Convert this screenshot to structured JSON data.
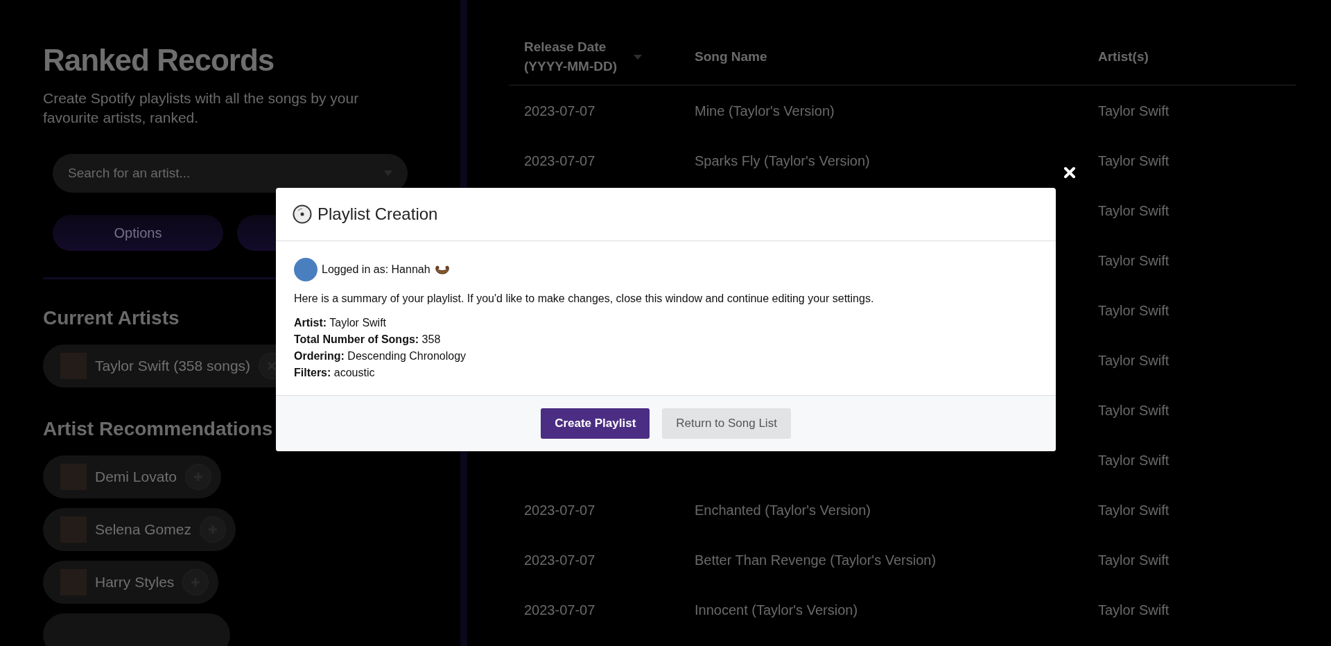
{
  "sidebar": {
    "title": "Ranked Records",
    "subtitle": "Create Spotify playlists with all the songs by your favourite artists, ranked.",
    "search": {
      "placeholder": "Search for an artist..."
    },
    "buttons": [
      {
        "label": "Options"
      }
    ],
    "current_artists_heading": "Current Artists",
    "current_artists": [
      {
        "name": "Taylor Swift (358 songs)"
      }
    ],
    "recommendations_heading": "Artist Recommendations",
    "recommendations": [
      {
        "name": "Demi Lovato"
      },
      {
        "name": "Selena Gomez"
      },
      {
        "name": "Harry Styles"
      }
    ]
  },
  "table": {
    "columns": [
      "Release Date (YYYY-MM-DD)",
      "Song Name",
      "Artist(s)"
    ],
    "rows": [
      {
        "date": "2023-07-07",
        "song": "Mine (Taylor's Version)",
        "artist": "Taylor Swift"
      },
      {
        "date": "2023-07-07",
        "song": "Sparks Fly (Taylor's Version)",
        "artist": "Taylor Swift"
      },
      {
        "artist": "Taylor Swift"
      },
      {
        "artist": "Taylor Swift"
      },
      {
        "artist": "Taylor Swift"
      },
      {
        "artist": "Taylor Swift"
      },
      {
        "artist": "Taylor Swift"
      },
      {
        "artist": "Taylor Swift"
      },
      {
        "date": "2023-07-07",
        "song": "Enchanted (Taylor's Version)",
        "artist": "Taylor Swift"
      },
      {
        "date": "2023-07-07",
        "song": "Better Than Revenge (Taylor's Version)",
        "artist": "Taylor Swift"
      },
      {
        "date": "2023-07-07",
        "song": "Innocent (Taylor's Version)",
        "artist": "Taylor Swift"
      }
    ]
  },
  "modal": {
    "title": "Playlist Creation",
    "logged_in": "Logged in as: Hannah",
    "summary": "Here is a summary of your playlist. If you'd like to make changes, close this window and continue editing your settings.",
    "details": [
      "**Artist:** Taylor Swift",
      "**Total Number of Songs:** 358",
      "**Ordering:** Descending Chronology",
      "**Filters:** acoustic"
    ],
    "buttons": [
      {
        "label": "Create Playlist",
        "kind": "primary"
      },
      {
        "label": "Return to Song List",
        "kind": "secondary"
      }
    ]
  }
}
